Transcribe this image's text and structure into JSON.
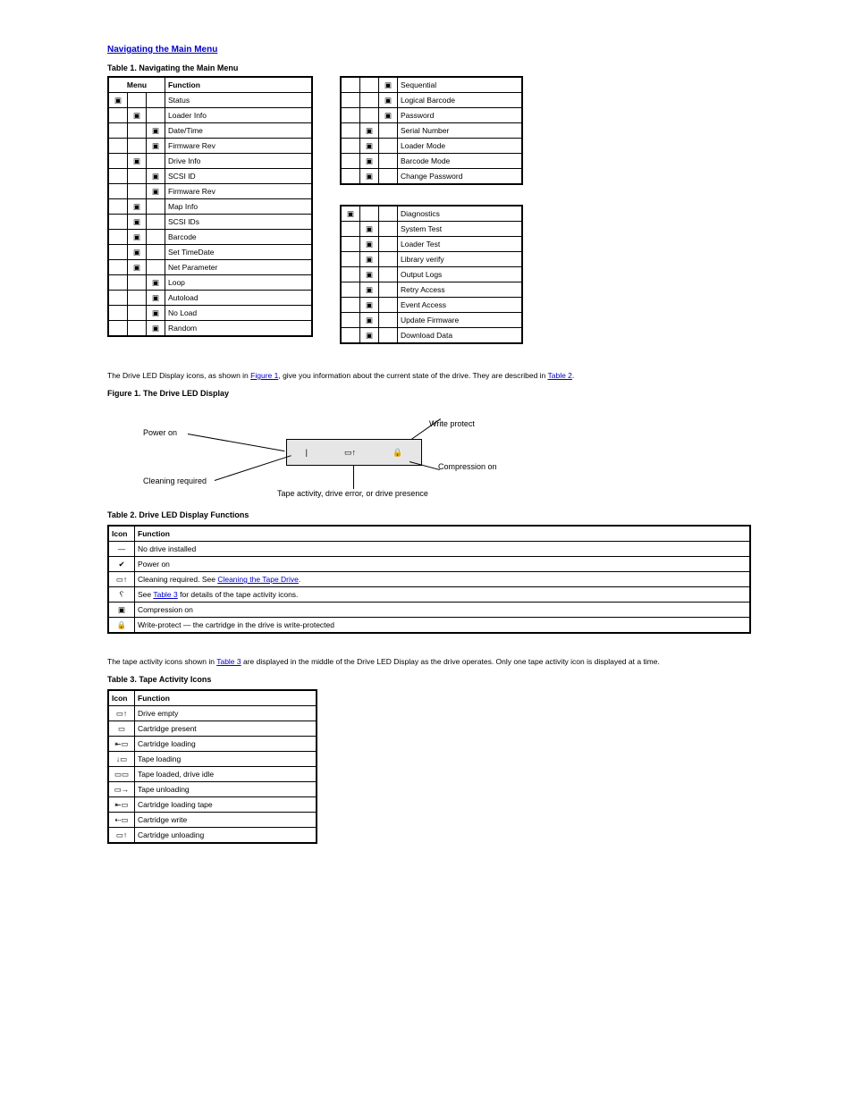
{
  "section1_title": "Navigating the Main Menu",
  "table1_intro": "Table 1. Navigating the Main Menu",
  "table1": {
    "headers": [
      "Menu",
      "",
      "",
      "Function"
    ],
    "rows": [
      {
        "a": "ic",
        "b": "",
        "c": "",
        "d": "Status"
      },
      {
        "a": "",
        "b": "ic",
        "c": "",
        "d": "Loader Info"
      },
      {
        "a": "",
        "b": "",
        "c": "ic",
        "d": "Date/Time"
      },
      {
        "a": "",
        "b": "",
        "c": "ic",
        "d": "Firmware Rev"
      },
      {
        "a": "",
        "b": "ic",
        "c": "",
        "d": "Drive Info"
      },
      {
        "a": "",
        "b": "",
        "c": "ic",
        "d": "SCSI ID"
      },
      {
        "a": "",
        "b": "",
        "c": "ic",
        "d": "Firmware Rev"
      },
      {
        "a": "",
        "b": "ic",
        "c": "",
        "d": "Map Info"
      },
      {
        "a": "",
        "b": "ic",
        "c": "",
        "d": "SCSI IDs"
      },
      {
        "a": "",
        "b": "ic",
        "c": "",
        "d": "Barcode"
      },
      {
        "a": "",
        "b": "ic",
        "c": "",
        "d": "Set TimeDate"
      },
      {
        "a": "",
        "b": "ic",
        "c": "",
        "d": "Net Parameter"
      },
      {
        "a": "",
        "b": "",
        "c": "ic",
        "d": "Loop"
      },
      {
        "a": "",
        "b": "",
        "c": "ic",
        "d": "Autoload"
      },
      {
        "a": "",
        "b": "",
        "c": "ic",
        "d": "No Load"
      },
      {
        "a": "",
        "b": "",
        "c": "ic",
        "d": "Random"
      }
    ]
  },
  "table2a": {
    "rows": [
      {
        "c": "ic",
        "d": "Sequential"
      },
      {
        "c": "ic",
        "d": "Logical Barcode"
      },
      {
        "c": "ic",
        "d": "Password"
      },
      {
        "b": "ic",
        "c": "",
        "d": "Serial Number"
      },
      {
        "b": "ic",
        "c": "",
        "d": "Loader Mode"
      },
      {
        "b": "ic",
        "c": "",
        "d": "Barcode Mode"
      },
      {
        "b": "ic",
        "c": "",
        "d": "Change Password"
      }
    ]
  },
  "table2b": {
    "rows": [
      {
        "a": "ic",
        "b": "",
        "c": "",
        "d": "Diagnostics"
      },
      {
        "a": "",
        "b": "ic",
        "c": "",
        "d": "System Test"
      },
      {
        "a": "",
        "b": "ic",
        "c": "",
        "d": "Loader Test"
      },
      {
        "a": "",
        "b": "ic",
        "c": "",
        "d": "Library verify"
      },
      {
        "a": "",
        "b": "ic",
        "c": "",
        "d": "Output Logs"
      },
      {
        "a": "",
        "b": "ic",
        "c": "",
        "d": "Retry Access"
      },
      {
        "a": "",
        "b": "ic",
        "c": "",
        "d": "Event Access"
      },
      {
        "a": "",
        "b": "ic",
        "c": "",
        "d": "Update Firmware"
      },
      {
        "a": "",
        "b": "ic",
        "c": "",
        "d": "Download Data"
      }
    ]
  },
  "section2_title": "Drive LED Display",
  "section2_text": "The Drive LED Display icons, as shown in ",
  "section2_link_text": "Figure 1",
  "section2_tail": ", give you information about the current state of the drive. They are described in ",
  "section2_link2": "Table 2",
  "section2_end": ".",
  "figure_labels": {
    "power_on": "Power on",
    "cleaning": "Cleaning required",
    "write_protect": "Write protect",
    "compression": "Compression on",
    "activity": "Tape activity, drive error, or drive presence"
  },
  "figure_caption": "Figure 1. The Drive LED Display",
  "table2_intro": "Table 2. Drive LED Display Functions",
  "table_leds": {
    "header_icon": "Icon",
    "header_func": "Function",
    "rows": [
      {
        "i": "—",
        "d": "No drive installed"
      },
      {
        "i": "ic",
        "d": "Power on"
      },
      {
        "i": "ic",
        "d": "Cleaning required",
        "link": true,
        "linktext": "Cleaning the Tape Drive"
      },
      {
        "i": "ic",
        "d": "See ",
        "after": " for details of the tape activity icons."
      },
      {
        "i": "ic",
        "d": "Compression on"
      },
      {
        "i": "ic",
        "d": "Write-protect — the cartridge in the drive is write-protected"
      }
    ],
    "link_inline": "Table 3"
  },
  "section3_text_pre": "The tape activity icons shown in ",
  "section3_link": "Table 3",
  "section3_text_post": " are displayed in the middle of the Drive LED Display as the drive operates. Only one tape activity icon is displayed at a time.",
  "table3_intro": "Table 3. Tape Activity Icons",
  "table_icons": {
    "header_icon": "Icon",
    "header_func": "Function",
    "rows": [
      {
        "d": "Drive empty"
      },
      {
        "d": "Cartridge present"
      },
      {
        "d": "Cartridge loading"
      },
      {
        "d": "Tape loading"
      },
      {
        "d": "Tape loaded, drive idle"
      },
      {
        "d": "Tape unloading"
      },
      {
        "d": "Cartridge loading tape"
      },
      {
        "d": "Cartridge write"
      },
      {
        "d": "Cartridge unloading"
      }
    ]
  }
}
